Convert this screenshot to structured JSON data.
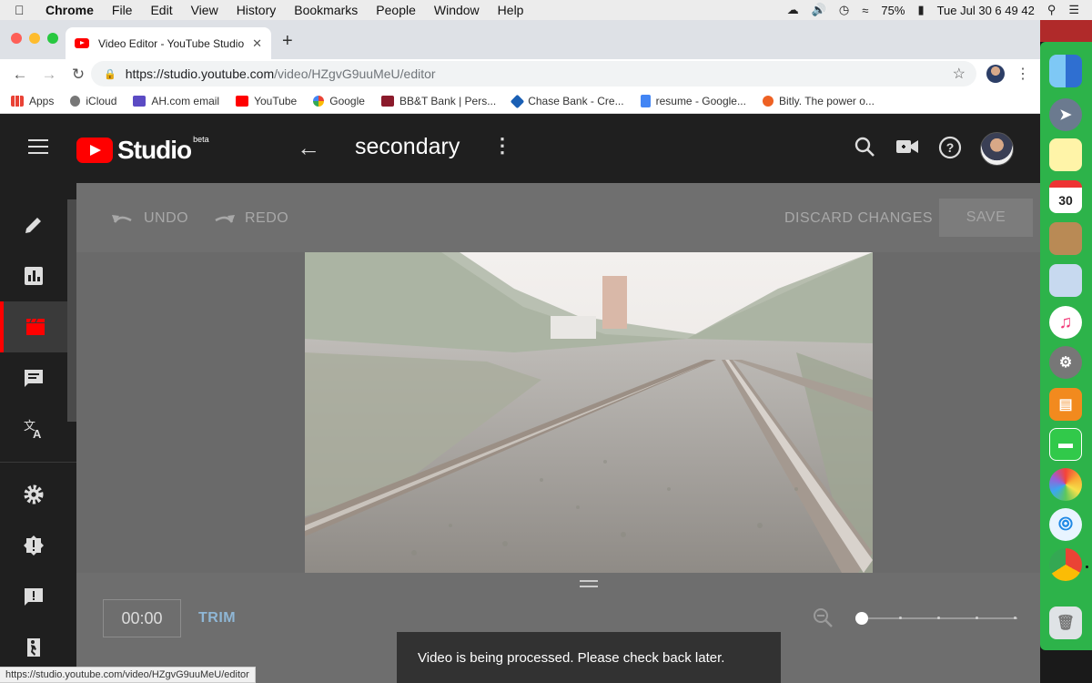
{
  "menubar": {
    "items": [
      "Chrome",
      "File",
      "Edit",
      "View",
      "History",
      "Bookmarks",
      "People",
      "Window",
      "Help"
    ],
    "battery": "75%",
    "clock": "Tue Jul 30  6 49 42"
  },
  "browser": {
    "tab_title": "Video Editor - YouTube Studio",
    "url_host": "https://studio.youtube.com",
    "url_path": "/video/HZgvG9uuMeU/editor",
    "bookmarks": [
      {
        "label": "Apps",
        "icon": "apps-grid-icon"
      },
      {
        "label": "iCloud",
        "icon": "apple-icon"
      },
      {
        "label": "AH.com email",
        "icon": "mail-icon"
      },
      {
        "label": "YouTube",
        "icon": "youtube-icon"
      },
      {
        "label": "Google",
        "icon": "google-icon"
      },
      {
        "label": "BB&T Bank | Pers...",
        "icon": "bbt-icon"
      },
      {
        "label": "Chase Bank - Cre...",
        "icon": "chase-icon"
      },
      {
        "label": "resume - Google...",
        "icon": "docs-icon"
      },
      {
        "label": "Bitly. The power o...",
        "icon": "bitly-icon"
      }
    ],
    "status_url": "https://studio.youtube.com/video/HZgvG9uuMeU/editor"
  },
  "studio": {
    "logo_text": "Studio",
    "logo_badge": "beta",
    "video_title": "secondary",
    "undo_label": "UNDO",
    "redo_label": "REDO",
    "discard_label": "DISCARD CHANGES",
    "save_label": "SAVE",
    "time_value": "00:00",
    "trim_label": "TRIM",
    "snackbar_text": "Video is being processed. Please check back later."
  },
  "colors": {
    "brand_red": "#ff0000",
    "dock_green": "#2db34a",
    "trim_blue": "#8fb7d6"
  }
}
